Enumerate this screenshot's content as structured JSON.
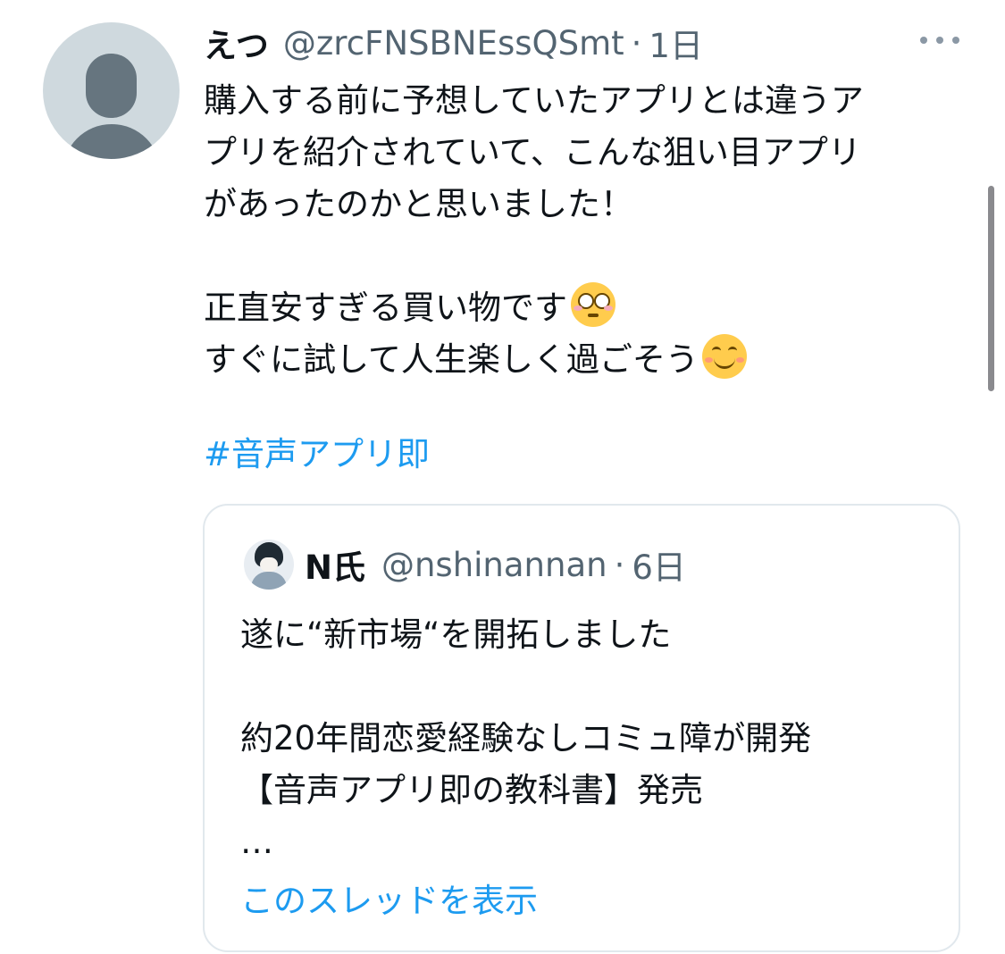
{
  "tweet": {
    "author_name": "えつ",
    "author_handle": "@zrcFNSBNEssQSmt",
    "separator": "·",
    "time": "1日",
    "lines": [
      "購入する前に予想していたアプリとは違うア",
      "プリを紹介されていて、こんな狙い目アプリ",
      "があったのかと思いました！",
      "",
      "正直安すぎる買い物です",
      "すぐに試して人生楽しく過ごそう"
    ],
    "emojis": [
      "flushed-face-emoji",
      "smiling-face-emoji"
    ],
    "hashtag": "#音声アプリ即"
  },
  "quoted_tweet": {
    "author_name": "N氏",
    "author_handle": "@nshinannan",
    "separator": "·",
    "time": "6日",
    "lines": [
      "遂に“新市場“を開拓しました",
      "",
      "約20年間恋愛経験なしコミュ障が開発",
      "【音声アプリ即の教科書】発売",
      "…"
    ],
    "show_thread_label": "このスレッドを表示"
  },
  "icons": {
    "more": "more-dots-icon",
    "avatar": "default-avatar-icon"
  },
  "colors": {
    "link": "#1d9bf0",
    "secondary_text": "#536471",
    "border": "#e1e8ed"
  }
}
